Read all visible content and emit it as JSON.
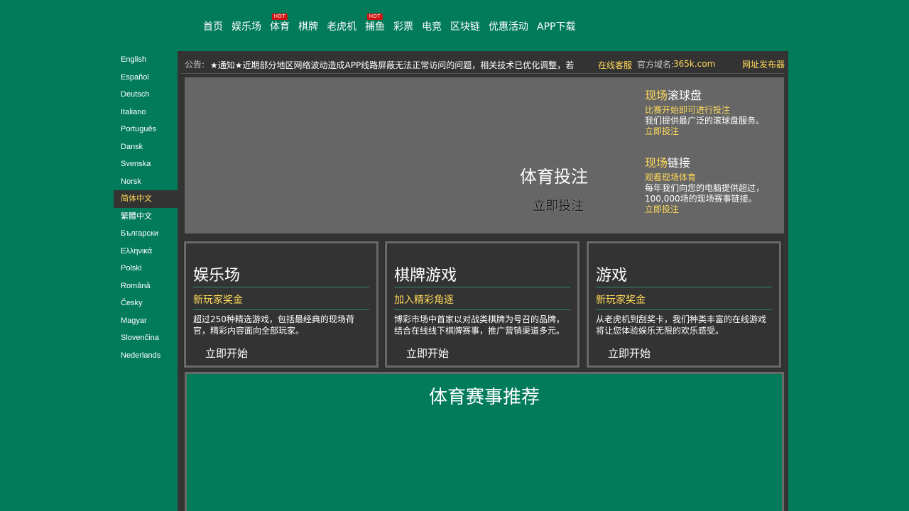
{
  "nav": {
    "items": [
      {
        "label": "首页",
        "hot": ""
      },
      {
        "label": "娱乐场",
        "hot": ""
      },
      {
        "label": "体育",
        "hot": "HOT"
      },
      {
        "label": "棋牌",
        "hot": ""
      },
      {
        "label": "老虎机",
        "hot": ""
      },
      {
        "label": "捕鱼",
        "hot": "HOT"
      },
      {
        "label": "彩票",
        "hot": ""
      },
      {
        "label": "电竞",
        "hot": ""
      },
      {
        "label": "区块链",
        "hot": ""
      },
      {
        "label": "优惠活动",
        "hot": ""
      },
      {
        "label": "APP下载",
        "hot": ""
      }
    ]
  },
  "languages": {
    "active_index": 8,
    "items": [
      "English",
      "Español",
      "Deutsch",
      "Italiano",
      "Português",
      "Dansk",
      "Svenska",
      "Norsk",
      "简体中文",
      "繁體中文",
      "Български",
      "Ελληνικά",
      "Polski",
      "Română",
      "Česky",
      "Magyar",
      "Slovenčina",
      "Nederlands"
    ]
  },
  "notice": {
    "label": "公告:",
    "text": "★通知★近期部分地区网络波动造成APP线路屏蔽无法正常访问的问题，相关技术已优化调整，若",
    "service": "在线客服",
    "domain_label": "官方域名:",
    "domain": "365k.com",
    "publisher": "网址发布器"
  },
  "banner": {
    "title": "体育投注",
    "button": "立即投注",
    "inplay": {
      "head_hl": "现场",
      "head_rest": "滚球盘",
      "sub": "比赛开始即可进行投注",
      "body": "我们提供最广泛的滚球盘服务。",
      "link": "立即投注"
    },
    "stream": {
      "head_hl": "现场",
      "head_rest": "链接",
      "sub": "观看现场体育",
      "body": "每年我们向您的电脑提供超过，100,000场的现场赛事链接。",
      "link": "立即投注"
    }
  },
  "cards": [
    {
      "title": "娱乐场",
      "sub": "新玩家奖金",
      "desc": "超过250种精选游戏，包括最经典的现场荷官，精彩内容面向全部玩家。",
      "button": "立即开始"
    },
    {
      "title": "棋牌游戏",
      "sub": "加入精彩角逐",
      "desc": "博彩市场中首家以对战类棋牌为号召的品牌，结合在线线下棋牌赛事，推广营销渠道多元。",
      "button": "立即开始"
    },
    {
      "title": "游戏",
      "sub": "新玩家奖金",
      "desc": "从老虎机到刮奖卡，我们种类丰富的在线游戏将让您体验娱乐无限的欢乐感受。",
      "button": "立即开始"
    }
  ],
  "recommend": {
    "title": "体育赛事推荐"
  }
}
